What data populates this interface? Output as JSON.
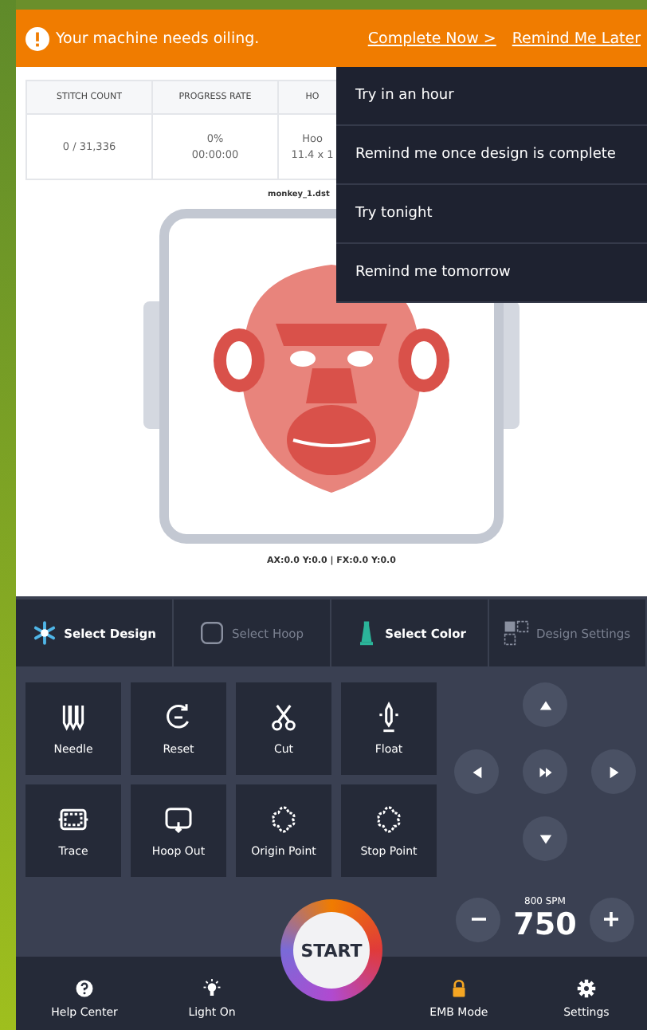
{
  "banner": {
    "message": "Your machine needs oiling.",
    "actions": [
      "Complete Now >",
      "Remind Me Later"
    ]
  },
  "stats": [
    {
      "label": "STITCH COUNT",
      "lines": [
        "0 / 31,336"
      ]
    },
    {
      "label": "PROGRESS RATE",
      "lines": [
        "0%",
        "00:00:00"
      ]
    },
    {
      "label": "HO",
      "lines": [
        "Hoo",
        "11.4 x 1"
      ]
    }
  ],
  "design": {
    "filename": "monkey_1.dst",
    "coordinates": "AX:0.0 Y:0.0 | FX:0.0 Y:0.0"
  },
  "dropdown": [
    "Try in an hour",
    "Remind me once design is complete",
    "Try tonight",
    "Remind me tomorrow"
  ],
  "tabs": [
    {
      "label": "Select Design",
      "kind": "design",
      "disabled": false
    },
    {
      "label": "Select Hoop",
      "kind": "hoop",
      "disabled": true
    },
    {
      "label": "Select Color",
      "kind": "thread",
      "disabled": false
    },
    {
      "label": "Design Settings",
      "kind": "layout",
      "disabled": true
    }
  ],
  "tools": [
    {
      "label": "Needle",
      "kind": "needle"
    },
    {
      "label": "Reset",
      "kind": "reset"
    },
    {
      "label": "Cut",
      "kind": "cut"
    },
    {
      "label": "Float",
      "kind": "float"
    },
    {
      "label": "Trace",
      "kind": "trace"
    },
    {
      "label": "Hoop Out",
      "kind": "hoopout"
    },
    {
      "label": "Origin Point",
      "kind": "flower"
    },
    {
      "label": "Stop Point",
      "kind": "flower"
    }
  ],
  "speed": {
    "limit": "800 SPM",
    "value": "750"
  },
  "start": "START",
  "bottom": [
    {
      "label": "Help Center",
      "kind": "help"
    },
    {
      "label": "Light On",
      "kind": "light"
    },
    {
      "label": "EMB Mode",
      "kind": "lock"
    },
    {
      "label": "Settings",
      "kind": "gear"
    }
  ]
}
